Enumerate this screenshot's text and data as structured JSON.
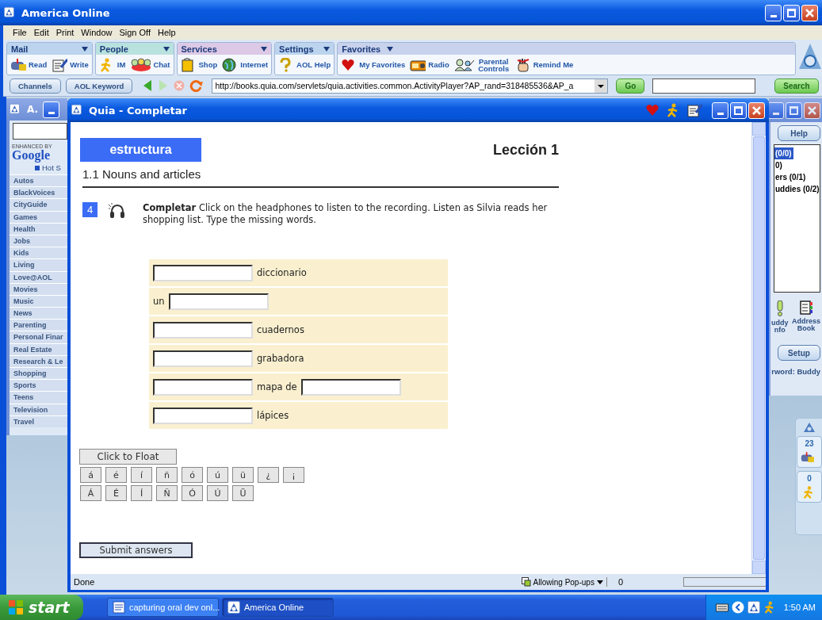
{
  "app_window": {
    "title": "America Online"
  },
  "menu": [
    "File",
    "Edit",
    "Print",
    "Window",
    "Sign Off",
    "Help"
  ],
  "toolbar_groups": [
    {
      "label": "Mail",
      "buttons": [
        "Read",
        "Write"
      ]
    },
    {
      "label": "People",
      "buttons": [
        "IM",
        "Chat"
      ]
    },
    {
      "label": "Services",
      "buttons": [
        "Shop",
        "Internet"
      ]
    },
    {
      "label": "Settings",
      "buttons": [
        "AOL Help"
      ]
    },
    {
      "label": "Favorites",
      "buttons": [
        "My Favorites",
        "Radio",
        "Parental Controls",
        "Remind Me"
      ]
    }
  ],
  "nav": {
    "buttons": [
      "Channels",
      "AOL Keyword"
    ],
    "url": "http://books.quia.com/servlets/quia.activities.common.ActivityPlayer?AP_rand=318485536&AP_a",
    "go": "Go",
    "search_button": "Search"
  },
  "channels_window": {
    "title": "A.",
    "enhanced_by": "ENHANCED BY",
    "google": "Google",
    "hot": "Hot S",
    "items": [
      "Autos",
      "BlackVoices",
      "CityGuide",
      "Games",
      "Health",
      "Jobs",
      "Kids",
      "Living",
      "Love@AOL",
      "Movies",
      "Music",
      "News",
      "Parenting",
      "Personal Finar",
      "Real Estate",
      "Research & Le",
      "Shopping",
      "Sports",
      "Teens",
      "Television",
      "Travel"
    ]
  },
  "buddy_window": {
    "help": "Help",
    "lines": [
      {
        "text": "(0/0)",
        "selected": true
      },
      {
        "text": "0)",
        "selected": false
      },
      {
        "text": "ers (0/1)",
        "selected": false
      },
      {
        "text": "uddies (0/2)",
        "selected": false
      }
    ],
    "tools": [
      [
        "uddy",
        "nfo"
      ],
      [
        "Address",
        "Book"
      ]
    ],
    "setup": "Setup",
    "footer": "rword: Buddy"
  },
  "aol_widget": {
    "mail_count": "23",
    "im_count": "0"
  },
  "quia_window": {
    "title": "Quia - Completar",
    "badge": "estructura",
    "lesson": "Lección 1",
    "section": "1.1 Nouns and articles",
    "exercise": {
      "number": "4",
      "text": "**Completar** Click on the headphones to listen to the recording. Listen as Silvia reads her shopping list. Type the missing words."
    },
    "rows": [
      {
        "parts": [
          {
            "kind": "field"
          },
          {
            "kind": "text",
            "text": "diccionario"
          }
        ]
      },
      {
        "parts": [
          {
            "kind": "text",
            "text": "un"
          },
          {
            "kind": "field"
          }
        ]
      },
      {
        "parts": [
          {
            "kind": "field"
          },
          {
            "kind": "text",
            "text": "cuadernos"
          }
        ]
      },
      {
        "parts": [
          {
            "kind": "field"
          },
          {
            "kind": "text",
            "text": "grabadora"
          }
        ]
      },
      {
        "parts": [
          {
            "kind": "field"
          },
          {
            "kind": "text",
            "text": "mapa de"
          },
          {
            "kind": "field"
          }
        ]
      },
      {
        "parts": [
          {
            "kind": "field"
          },
          {
            "kind": "text",
            "text": "lápices"
          }
        ]
      }
    ],
    "float_button": "Click to Float",
    "accent_keys": [
      [
        "á",
        "é",
        "í",
        "ñ",
        "ó",
        "ú",
        "ü",
        "¿",
        "¡"
      ],
      [
        "Á",
        "É",
        "Í",
        "Ñ",
        "Ó",
        "Ú",
        "Ü"
      ]
    ],
    "submit": "Submit answers",
    "status": {
      "text": "Done",
      "popups": "Allowing Pop-ups",
      "count": "0",
      "progress": {
        "level": 0
      }
    }
  },
  "taskbar": {
    "start": "start",
    "tasks": [
      {
        "label": "capturing oral dev onl...",
        "selected": false
      },
      {
        "label": "America  Online",
        "selected": true
      }
    ],
    "clock": "1:50 AM"
  }
}
